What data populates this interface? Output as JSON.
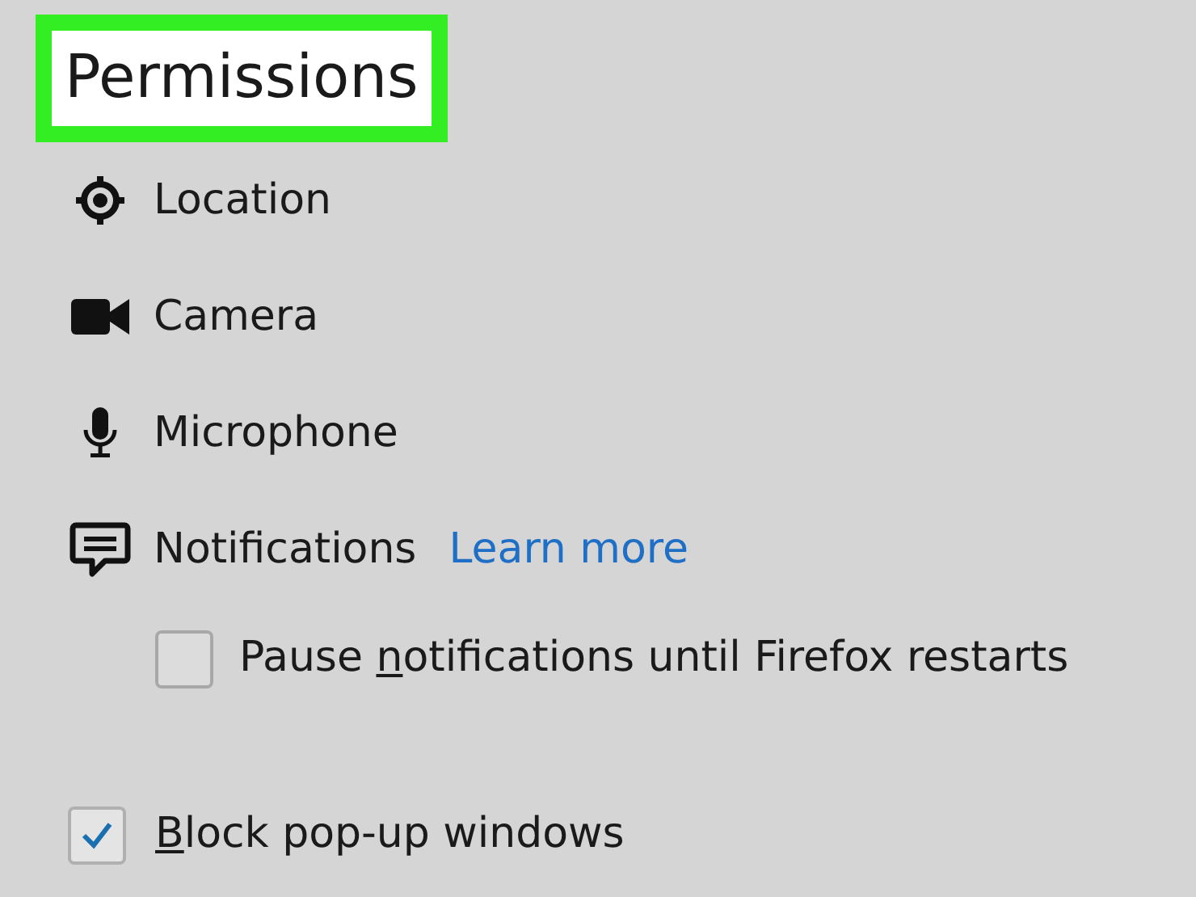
{
  "title": {
    "text": "Permissions",
    "highlighted": true
  },
  "permissions": [
    {
      "kind": "location",
      "label": "Location"
    },
    {
      "kind": "camera",
      "label": "Camera"
    },
    {
      "kind": "microphone",
      "label": "Microphone"
    },
    {
      "kind": "notifications",
      "label": "Notifications",
      "link": "Learn more"
    }
  ],
  "pause_notifications": {
    "before": "Pause ",
    "key": "n",
    "after": "otifications until Firefox restarts",
    "checked": false
  },
  "block_popups": {
    "key": "B",
    "after": "lock pop-up windows",
    "checked": true
  }
}
